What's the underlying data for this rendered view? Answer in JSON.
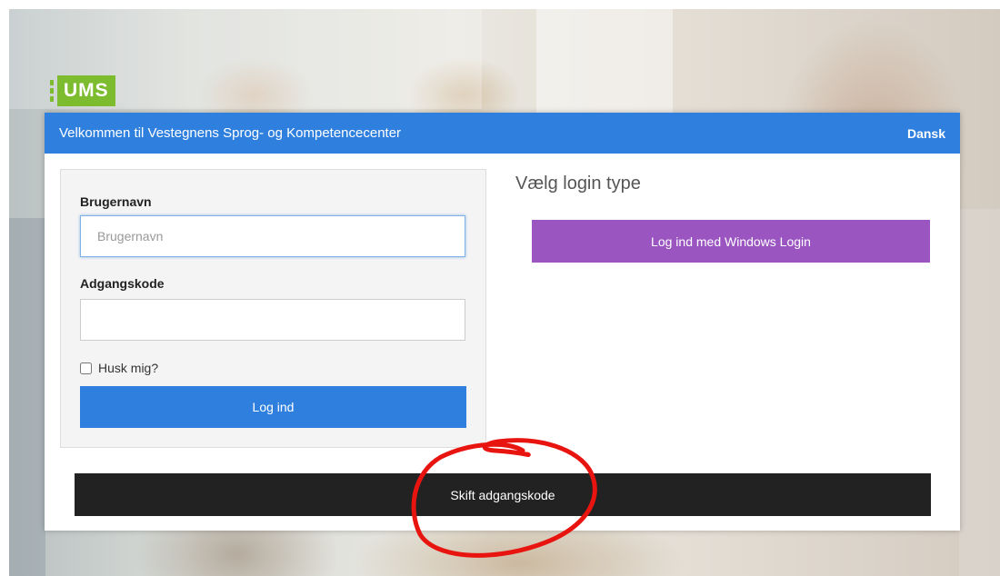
{
  "brand": {
    "logo_text": "UMS",
    "color": "#7dbb2f"
  },
  "header": {
    "title": "Velkommen til Vestegnens Sprog- og Kompetencecenter",
    "language": "Dansk",
    "color": "#2f80de"
  },
  "login_form": {
    "username_label": "Brugernavn",
    "username_placeholder": "Brugernavn",
    "username_value": "",
    "password_label": "Adgangskode",
    "password_value": "",
    "remember_label": "Husk mig?",
    "remember_checked": false,
    "submit_label": "Log ind"
  },
  "login_type": {
    "title": "Vælg login type",
    "windows_button_label": "Log ind med Windows Login",
    "windows_button_color": "#9b55c1"
  },
  "change_password": {
    "label": "Skift adgangskode"
  },
  "annotation": {
    "shape": "hand-drawn red circle",
    "color": "#e8140f"
  }
}
